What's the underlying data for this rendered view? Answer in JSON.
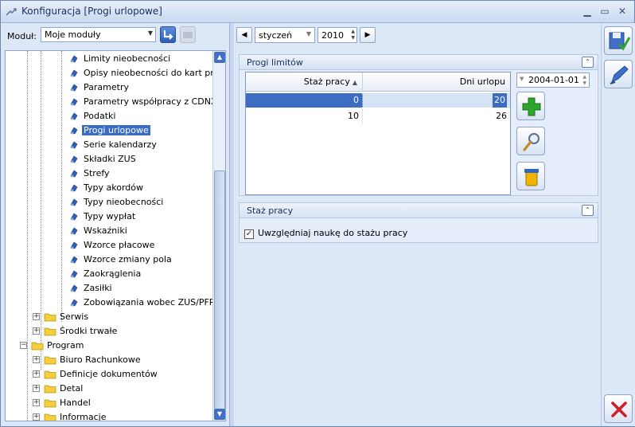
{
  "window": {
    "title": "Konfiguracja [Progi urlopowe]"
  },
  "module": {
    "label": "Moduł:",
    "value": "Moje moduły"
  },
  "tree": {
    "items": [
      {
        "label": "Limity nieobecności",
        "level": 2,
        "type": "doc"
      },
      {
        "label": "Opisy nieobecności do kart pracy",
        "level": 2,
        "type": "doc"
      },
      {
        "label": "Parametry",
        "level": 2,
        "type": "doc"
      },
      {
        "label": "Parametry współpracy z CDNXL",
        "level": 2,
        "type": "doc"
      },
      {
        "label": "Podatki",
        "level": 2,
        "type": "doc"
      },
      {
        "label": "Progi urlopowe",
        "level": 2,
        "type": "doc",
        "selected": true
      },
      {
        "label": "Serie kalendarzy",
        "level": 2,
        "type": "doc"
      },
      {
        "label": "Składki ZUS",
        "level": 2,
        "type": "doc"
      },
      {
        "label": "Strefy",
        "level": 2,
        "type": "doc"
      },
      {
        "label": "Typy akordów",
        "level": 2,
        "type": "doc"
      },
      {
        "label": "Typy nieobecności",
        "level": 2,
        "type": "doc"
      },
      {
        "label": "Typy wypłat",
        "level": 2,
        "type": "doc"
      },
      {
        "label": "Wskaźniki",
        "level": 2,
        "type": "doc"
      },
      {
        "label": "Wzorce płacowe",
        "level": 2,
        "type": "doc"
      },
      {
        "label": "Wzorce zmiany pola",
        "level": 2,
        "type": "doc"
      },
      {
        "label": "Zaokrąglenia",
        "level": 2,
        "type": "doc"
      },
      {
        "label": "Zasiłki",
        "level": 2,
        "type": "doc"
      },
      {
        "label": "Zobowiązania wobec ZUS/PFRON",
        "level": 2,
        "type": "doc"
      },
      {
        "label": "Serwis",
        "level": 1,
        "type": "folder",
        "expander": "+"
      },
      {
        "label": "Środki trwałe",
        "level": 1,
        "type": "folder",
        "expander": "+"
      },
      {
        "label": "Program",
        "level": 0,
        "type": "folder",
        "expander": "-"
      },
      {
        "label": "Biuro Rachunkowe",
        "level": 1,
        "type": "folder",
        "expander": "+"
      },
      {
        "label": "Definicje dokumentów",
        "level": 1,
        "type": "folder",
        "expander": "+"
      },
      {
        "label": "Detal",
        "level": 1,
        "type": "folder",
        "expander": "+"
      },
      {
        "label": "Handel",
        "level": 1,
        "type": "folder",
        "expander": "+"
      },
      {
        "label": "Informacje",
        "level": 1,
        "type": "folder",
        "expander": "+"
      }
    ]
  },
  "period": {
    "month": "styczeń",
    "year": "2010"
  },
  "progi": {
    "title": "Progi limitów",
    "columns": [
      "Staż pracy",
      "Dni urlopu"
    ],
    "rows": [
      {
        "staz": "0",
        "dni": "20",
        "selected": true
      },
      {
        "staz": "10",
        "dni": "26"
      }
    ],
    "date": "2004-01-01"
  },
  "staz": {
    "title": "Staż pracy",
    "checkbox_label": "Uwzględniaj naukę do stażu pracy",
    "checked": true
  },
  "colors": {
    "selection": "#3c6dc2",
    "accent": "#3f6fc6",
    "add_green": "#2fa52f",
    "close_red": "#d2202a"
  }
}
